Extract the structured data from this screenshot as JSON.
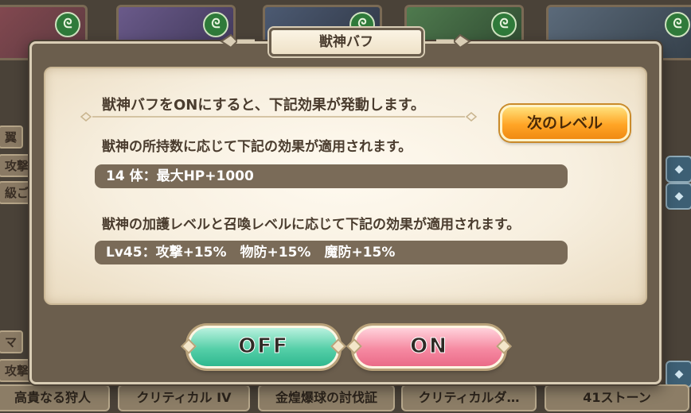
{
  "dialog": {
    "title": "獣神バフ",
    "headline": "獣神バフをONにすると、下記効果が発動します。",
    "next_level_label": "次のレベル",
    "section1_text": "獣神の所持数に応じて下記の効果が適用されます。",
    "section1_value": "14 体：最大HP+1000",
    "section2_text": "獣神の加護レベルと召喚レベルに応じて下記の効果が適用されます。",
    "section2_value": "Lv45：攻撃+15%　物防+15%　魔防+15%",
    "off_label": "OFF",
    "on_label": "ON"
  },
  "background": {
    "side_tags": [
      "翼",
      "攻撃+",
      "級ご",
      "マ",
      "攻撃:"
    ],
    "bottom_tabs": [
      "高貴なる狩人",
      "クリティカル IV",
      "金煌爆球の討伐証",
      "クリティカルダ…",
      "41ストーン"
    ],
    "card_badge_icon": "leaf-emblem-icon"
  },
  "colors": {
    "dialog_frame": "#6b5e4d",
    "panel_bg": "#f7efdf",
    "value_bar": "#7a6b58",
    "next_button": "#ffa526",
    "off_button": "#55cfa8",
    "on_button": "#f68aa2"
  }
}
